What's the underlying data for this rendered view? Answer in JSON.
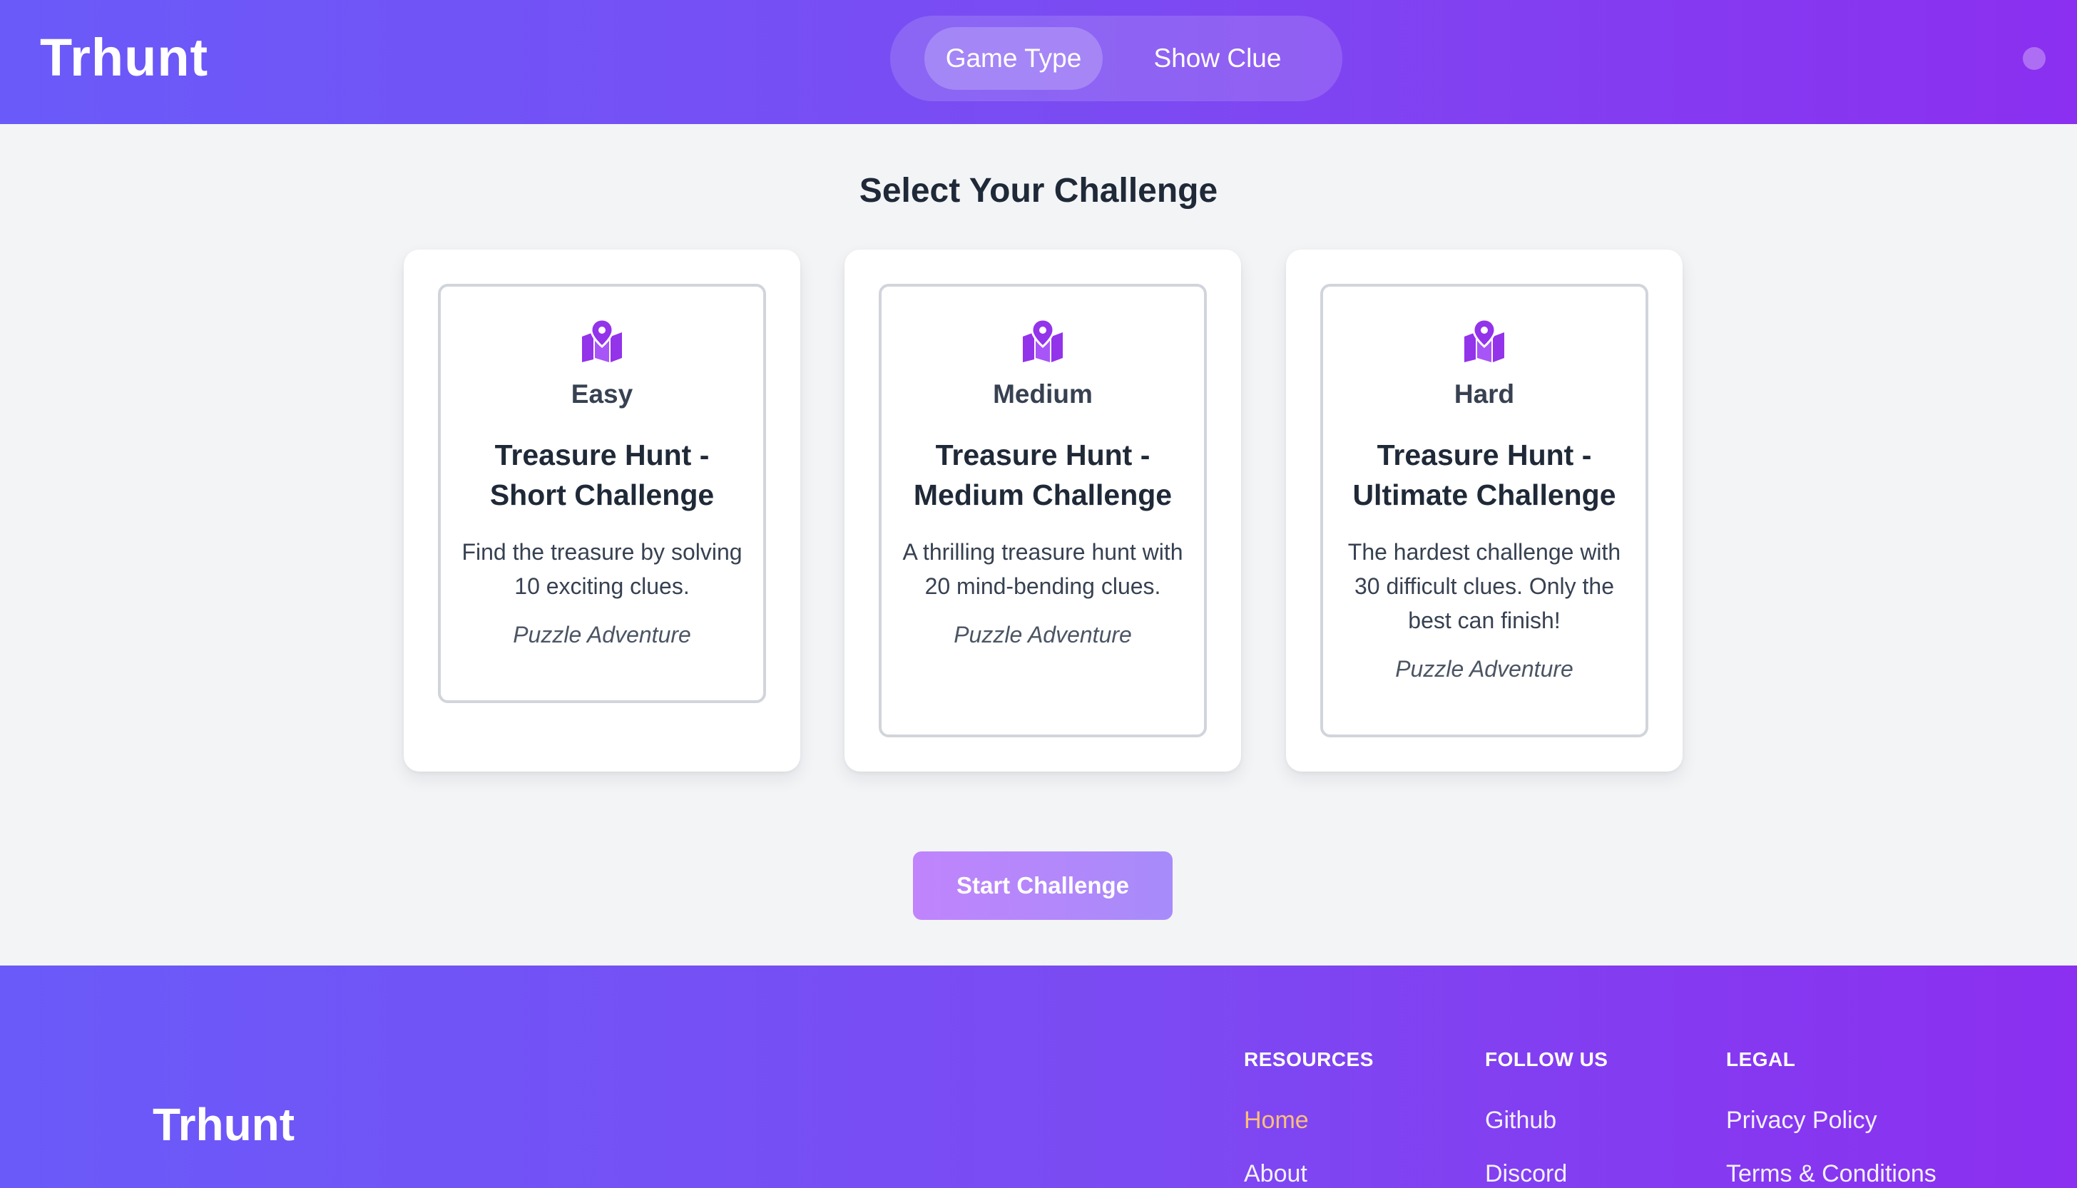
{
  "header": {
    "logo": "Trhunt",
    "nav": [
      {
        "label": "Game Type",
        "active": true
      },
      {
        "label": "Show Clue",
        "active": false
      }
    ]
  },
  "main": {
    "title": "Select Your Challenge",
    "cards": [
      {
        "icon": "map-pin-icon",
        "level": "Easy",
        "title": "Treasure Hunt - Short Challenge",
        "description": "Find the treasure by solving 10 exciting clues.",
        "tag": "Puzzle Adventure"
      },
      {
        "icon": "map-pin-icon",
        "level": "Medium",
        "title": "Treasure Hunt - Medium Challenge",
        "description": "A thrilling treasure hunt with 20 mind-bending clues.",
        "tag": "Puzzle Adventure"
      },
      {
        "icon": "map-pin-icon",
        "level": "Hard",
        "title": "Treasure Hunt - Ultimate Challenge",
        "description": "The hardest challenge with 30 difficult clues. Only the best can finish!",
        "tag": "Puzzle Adventure"
      }
    ],
    "start_button": "Start Challenge"
  },
  "footer": {
    "logo": "Trhunt",
    "columns": [
      {
        "heading": "RESOURCES",
        "links": [
          "Home",
          "About"
        ]
      },
      {
        "heading": "FOLLOW US",
        "links": [
          "Github",
          "Discord"
        ]
      },
      {
        "heading": "LEGAL",
        "links": [
          "Privacy Policy",
          "Terms & Conditions"
        ]
      }
    ]
  },
  "colors": {
    "brand_gradient_start": "#6a5af9",
    "brand_gradient_end": "#8b2ff0",
    "icon_accent": "#9333ea",
    "active_link": "#fbbf7a"
  }
}
